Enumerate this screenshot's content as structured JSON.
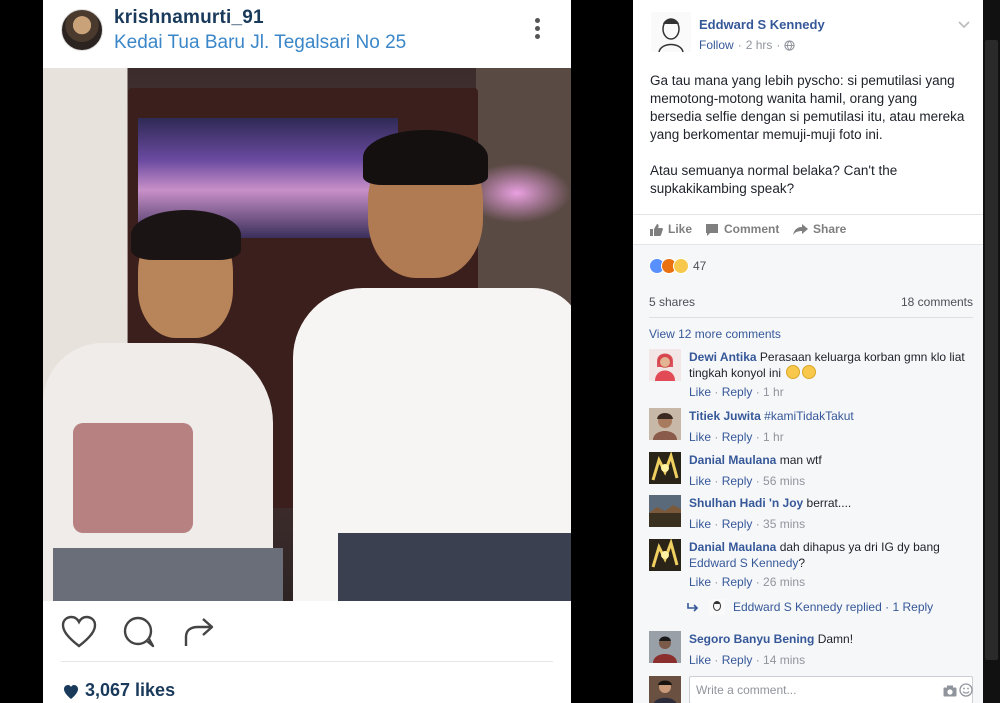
{
  "instagram": {
    "username": "krishnamurti_91",
    "location": "Kedai Tua Baru Jl. Tegalsari No 25",
    "likes": "3,067 likes",
    "icons": [
      "heart-icon",
      "comment-icon",
      "share-icon",
      "more-options-icon"
    ]
  },
  "facebook": {
    "author": "Eddward S Kennedy",
    "follow": "Follow",
    "time": "2 hrs",
    "paragraph1": "Ga tau mana yang lebih pyscho: si pemutilasi yang memotong-motong wanita hamil, orang yang bersedia selfie dengan si pemutilasi itu, atau mereka yang berkomentar memuji-muji foto ini.",
    "paragraph2": "Atau semuanya normal belaka? Can't the supkakikambing speak?",
    "actions": {
      "like": "Like",
      "comment": "Comment",
      "share": "Share"
    },
    "reactions_count": "47",
    "shares": "5 shares",
    "comments_count": "18 comments",
    "view_more": "View 12 more comments",
    "meta_like": "Like",
    "meta_reply": "Reply",
    "comments": [
      {
        "name": "Dewi Antika",
        "text": "Perasaan keluarga korban gmn klo liat tingkah konyol ini",
        "time": "1 hr"
      },
      {
        "name": "Titiek Juwita",
        "text": "#kamiTidakTakut",
        "time": "1 hr"
      },
      {
        "name": "Danial Maulana",
        "text": "man wtf",
        "time": "56 mins"
      },
      {
        "name": "Shulhan Hadi 'n Joy",
        "text": "berrat....",
        "time": "35 mins"
      },
      {
        "name": "Danial Maulana",
        "text": "dah dihapus ya dri IG dy bang",
        "tag": "Eddward S Kennedy",
        "tag_suffix": "?",
        "time": "26 mins"
      },
      {
        "name": "Segoro Banyu Bening",
        "text": "Damn!",
        "time": "14 mins"
      }
    ],
    "reply_summary": {
      "name": "Eddward S Kennedy",
      "text": "replied",
      "sep": "·",
      "count": "1 Reply"
    },
    "write_placeholder": "Write a comment...",
    "colors": {
      "link": "#365899",
      "meta": "#90949c",
      "ig_link": "#3a86c8"
    }
  }
}
